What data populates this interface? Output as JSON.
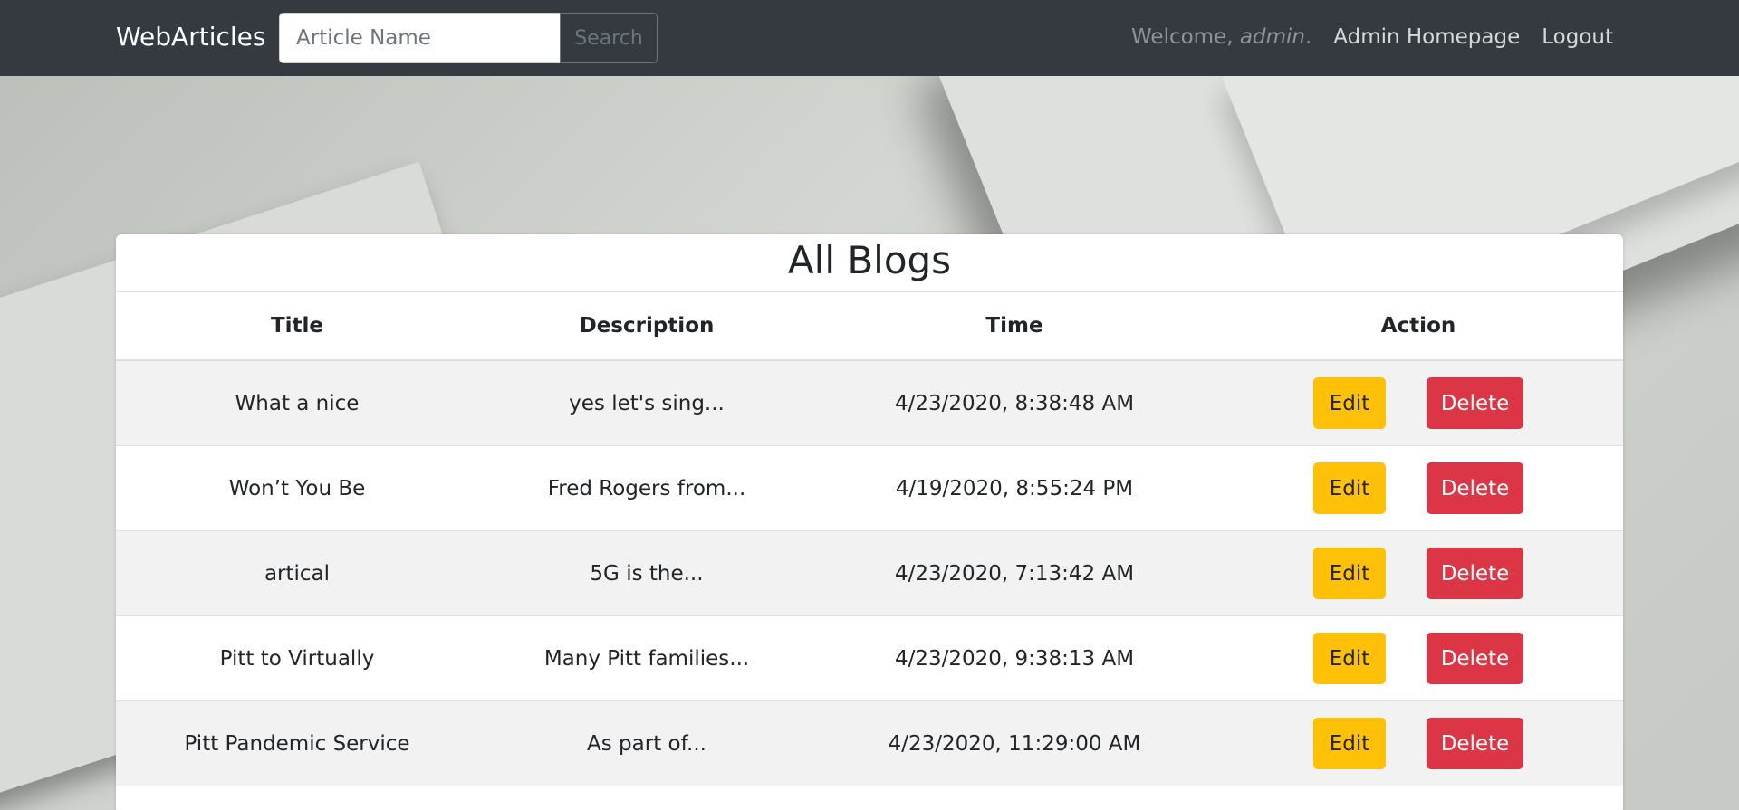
{
  "navbar": {
    "brand": "WebArticles",
    "search": {
      "placeholder": "Article Name",
      "value": "",
      "button_label": "Search"
    },
    "welcome_prefix": "Welcome, ",
    "welcome_user": "admin",
    "welcome_suffix": ".",
    "admin_home_label": "Admin Homepage",
    "logout_label": "Logout"
  },
  "card": {
    "title": "All Blogs",
    "columns": [
      "Title",
      "Description",
      "Time",
      "Action"
    ],
    "rows": [
      {
        "title": "What a nice",
        "description": "yes let's sing...",
        "time": "4/23/2020, 8:38:48 AM"
      },
      {
        "title": "Won’t You Be",
        "description": "Fred Rogers from...",
        "time": "4/19/2020, 8:55:24 PM"
      },
      {
        "title": "artical",
        "description": "5G is the...",
        "time": "4/23/2020, 7:13:42 AM"
      },
      {
        "title": "Pitt to Virtually",
        "description": "Many Pitt families...",
        "time": "4/23/2020, 9:38:13 AM"
      },
      {
        "title": "Pitt Pandemic Service",
        "description": "As part of...",
        "time": "4/23/2020, 11:29:00 AM"
      }
    ],
    "edit_label": "Edit",
    "delete_label": "Delete"
  },
  "colors": {
    "navbar_bg": "#343a40",
    "edit_bg": "#ffc107",
    "delete_bg": "#dc3545"
  }
}
